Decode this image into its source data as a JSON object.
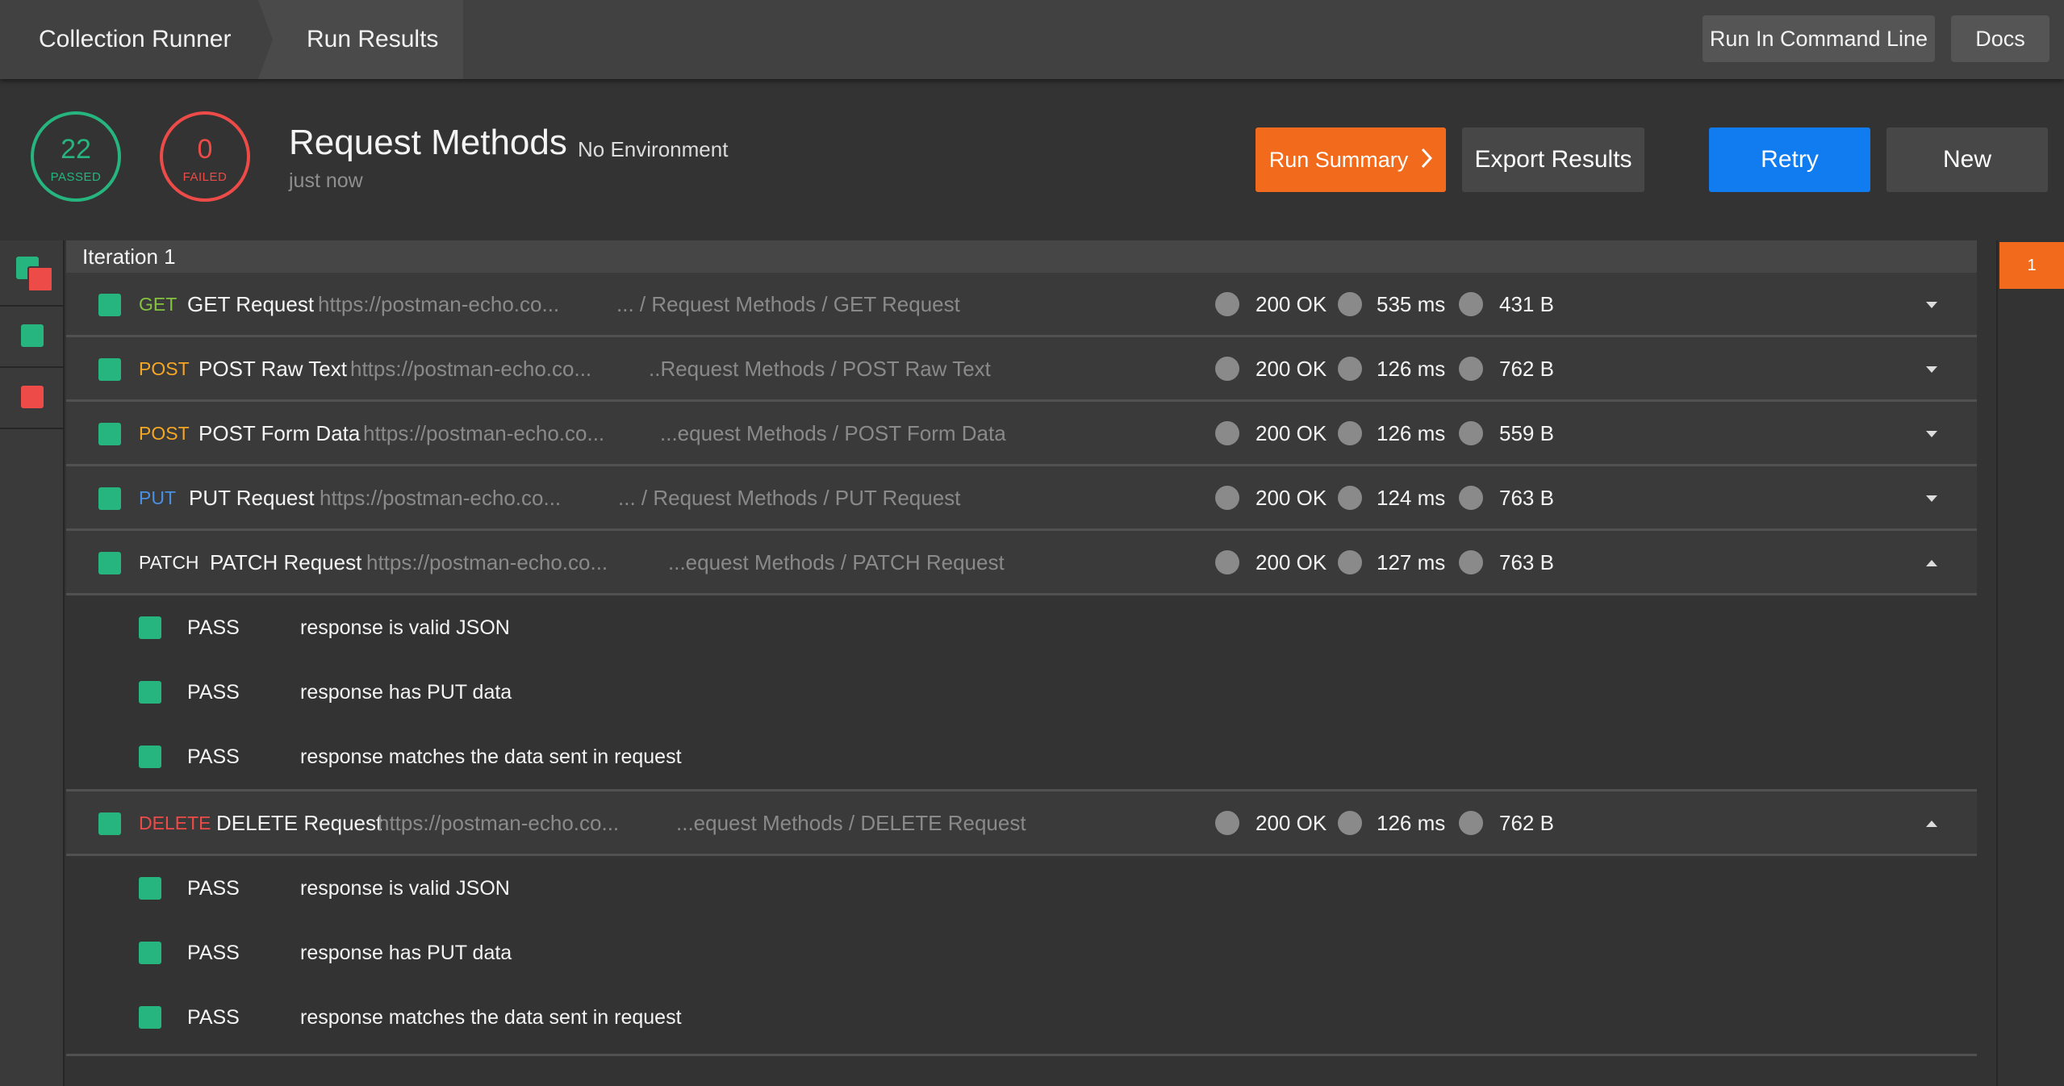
{
  "breadcrumb": {
    "root": "Collection Runner",
    "current": "Run Results"
  },
  "top_buttons": {
    "command_line": "Run In Command Line",
    "docs": "Docs"
  },
  "stats": {
    "passed": "22",
    "passed_label": "PASSED",
    "failed": "0",
    "failed_label": "FAILED"
  },
  "run": {
    "collection": "Request Methods",
    "environment": "No Environment",
    "time": "just now"
  },
  "actions": {
    "summary": "Run Summary",
    "export": "Export Results",
    "retry": "Retry",
    "new": "New"
  },
  "iteration_label": "Iteration 1",
  "iterations": [
    "1"
  ],
  "colors": {
    "pass": "#26b47f",
    "fail": "#ed4b48",
    "accent": "#f26b1d",
    "primary": "#107cf0"
  },
  "requests": [
    {
      "method": "GET",
      "name": "GET Request",
      "url": "https://postman-echo.co...",
      "path": "... / Request Methods / GET Request",
      "status": "200 OK",
      "time": "535 ms",
      "size": "431 B",
      "expanded": false,
      "tests": []
    },
    {
      "method": "POST",
      "name": "POST Raw Text",
      "url": "https://postman-echo.co...",
      "path": "..Request Methods / POST Raw Text",
      "status": "200 OK",
      "time": "126 ms",
      "size": "762 B",
      "expanded": false,
      "tests": []
    },
    {
      "method": "POST",
      "name": "POST Form Data",
      "url": "https://postman-echo.co...",
      "path": "...equest Methods / POST Form Data",
      "status": "200 OK",
      "time": "126 ms",
      "size": "559 B",
      "expanded": false,
      "tests": []
    },
    {
      "method": "PUT",
      "name": "PUT Request",
      "url": "https://postman-echo.co...",
      "path": "... / Request Methods / PUT Request",
      "status": "200 OK",
      "time": "124 ms",
      "size": "763 B",
      "expanded": false,
      "tests": []
    },
    {
      "method": "PATCH",
      "name": "PATCH Request",
      "url": "https://postman-echo.co...",
      "path": "...equest Methods / PATCH Request",
      "status": "200 OK",
      "time": "127 ms",
      "size": "763 B",
      "expanded": true,
      "tests": [
        {
          "status": "PASS",
          "name": "response is valid JSON"
        },
        {
          "status": "PASS",
          "name": "response has PUT data"
        },
        {
          "status": "PASS",
          "name": "response matches the data sent in request"
        }
      ]
    },
    {
      "method": "DELETE",
      "name": "DELETE Request",
      "url": "https://postman-echo.co...",
      "path": "...equest Methods / DELETE Request",
      "status": "200 OK",
      "time": "126 ms",
      "size": "762 B",
      "expanded": true,
      "tests": [
        {
          "status": "PASS",
          "name": "response is valid JSON"
        },
        {
          "status": "PASS",
          "name": "response has PUT data"
        },
        {
          "status": "PASS",
          "name": "response matches the data sent in request"
        }
      ]
    }
  ]
}
